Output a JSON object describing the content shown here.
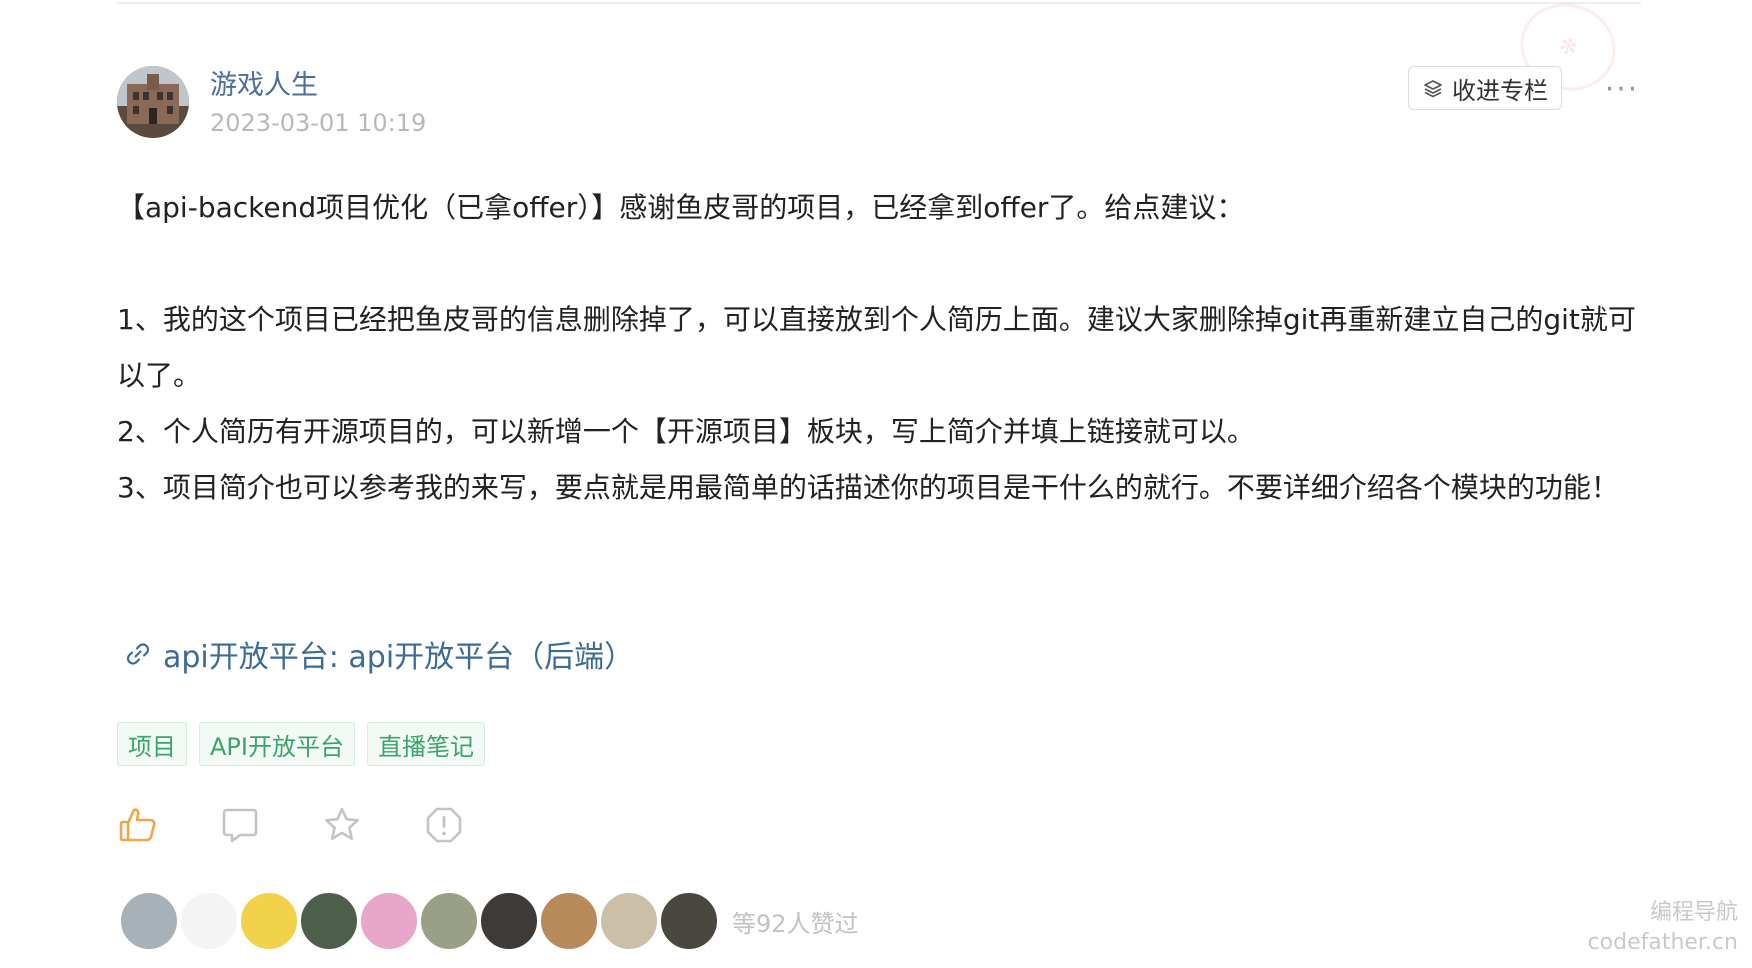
{
  "post": {
    "author": {
      "name": "游戏人生",
      "time": "2023-03-01 10:19"
    },
    "collect_label": "收进专栏",
    "more_label": "···",
    "paragraphs": [
      "【api-backend项目优化（已拿offer）】感谢鱼皮哥的项目，已经拿到offer了。给点建议：",
      "",
      "1、我的这个项目已经把鱼皮哥的信息删除掉了，可以直接放到个人简历上面。建议大家删除掉git再重新建立自己的git就可以了。",
      "2、个人简历有开源项目的，可以新增一个【开源项目】板块，写上简介并填上链接就可以。",
      "3、项目简介也可以参考我的来写，要点就是用最简单的话描述你的项目是干什么的就行。不要详细介绍各个模块的功能！"
    ],
    "link": {
      "text": "api开放平台: api开放平台（后端）",
      "icon": "link-icon"
    },
    "tags": [
      "项目",
      "API开放平台",
      "直播笔记"
    ],
    "actions": [
      {
        "name": "like-button",
        "icon": "thumbs-up-icon"
      },
      {
        "name": "comment-button",
        "icon": "comment-icon"
      },
      {
        "name": "favorite-button",
        "icon": "star-icon"
      },
      {
        "name": "report-button",
        "icon": "alert-icon"
      }
    ],
    "likers": {
      "count_text": "等92人赞过",
      "avatars": [
        {
          "name": "liker-1",
          "color": "#a8b0b8"
        },
        {
          "name": "liker-2",
          "color": "#f4f4f4"
        },
        {
          "name": "liker-3",
          "color": "#f2d24a"
        },
        {
          "name": "liker-4",
          "color": "#4e5e4c"
        },
        {
          "name": "liker-5",
          "color": "#e8a6c8"
        },
        {
          "name": "liker-6",
          "color": "#9aa086"
        },
        {
          "name": "liker-7",
          "color": "#3d3a38"
        },
        {
          "name": "liker-8",
          "color": "#b8895a"
        },
        {
          "name": "liker-9",
          "color": "#cbbfa7"
        },
        {
          "name": "liker-10",
          "color": "#4a4640"
        }
      ]
    }
  },
  "watermark": {
    "line1": "编程导航",
    "line2": "codefather.cn"
  },
  "colors": {
    "author_name": "#4a6f9a",
    "link": "#3d6b98",
    "tag_text": "#3aa46b",
    "tag_bg": "#f3faf5",
    "like_icon": "#f0a54a"
  }
}
